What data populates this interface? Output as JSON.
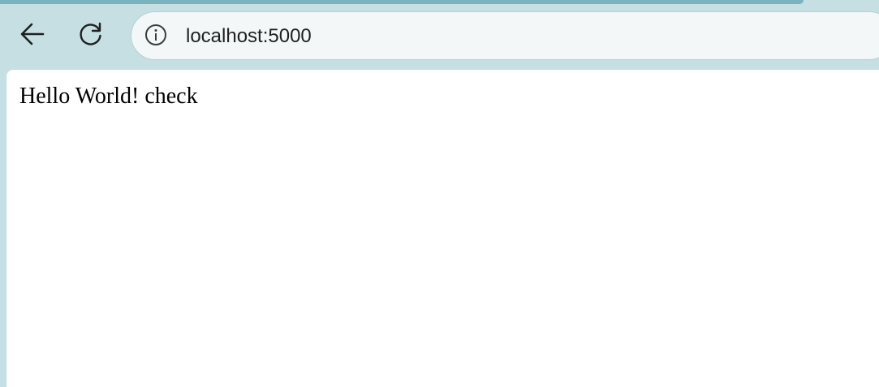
{
  "browser": {
    "toolbar": {
      "back_icon": "arrow-left-icon",
      "reload_icon": "reload-icon",
      "site_info_icon": "info-icon",
      "url": "localhost:5000"
    },
    "colors": {
      "frame": "#c5dfe3",
      "tab_accent": "#7ab2bd",
      "address_bar": "#f3f7f8",
      "page_background": "#ffffff"
    }
  },
  "page": {
    "body_text": "Hello World! check"
  }
}
